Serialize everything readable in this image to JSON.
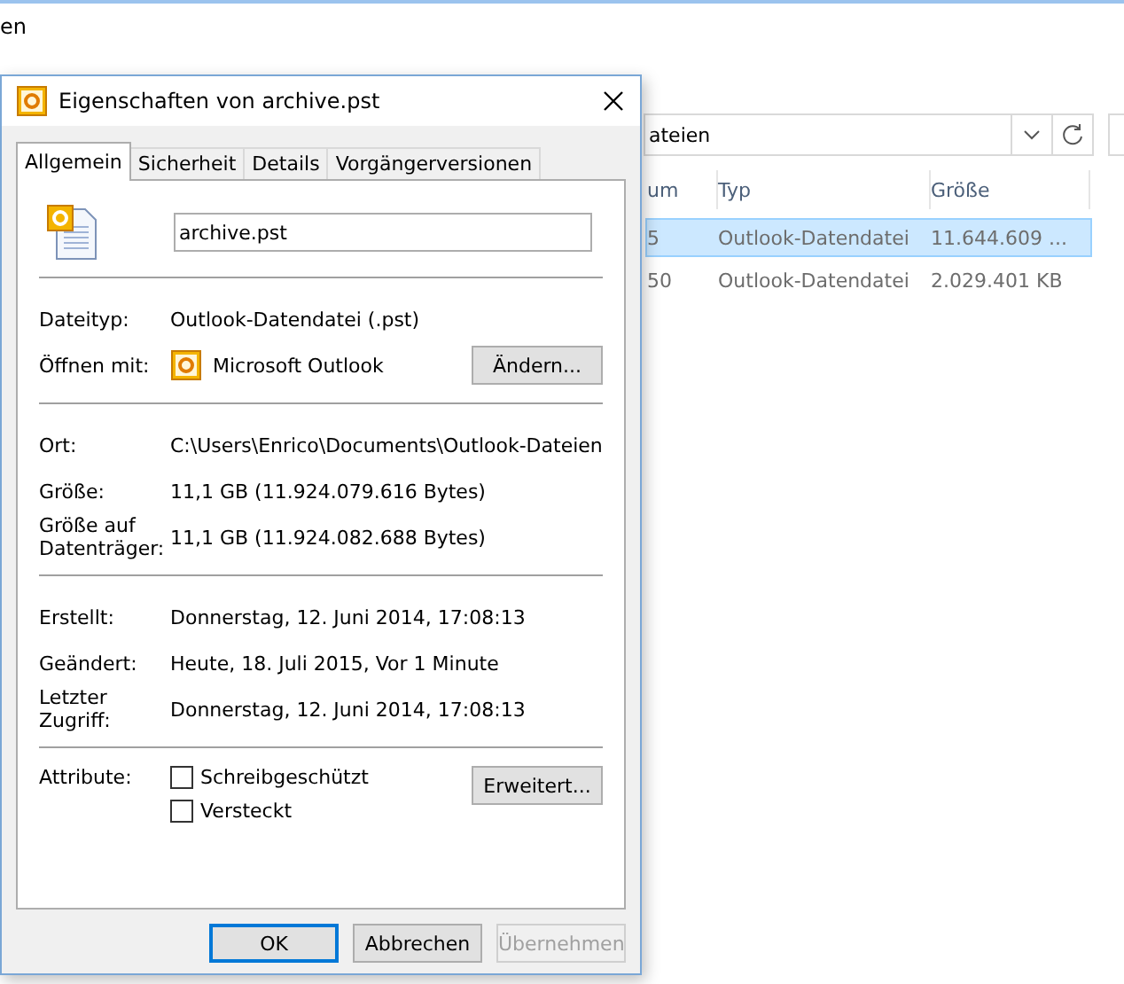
{
  "explorer": {
    "title_fragment": "en",
    "address": "ateien",
    "columns": [
      "um",
      "Typ",
      "Größe"
    ],
    "rows": [
      {
        "cells": [
          "5",
          "Outlook-Datendatei",
          "11.644.609 ..."
        ],
        "selected": true
      },
      {
        "cells": [
          "50",
          "Outlook-Datendatei",
          "2.029.401 KB"
        ],
        "selected": false
      }
    ]
  },
  "dialog": {
    "title": "Eigenschaften von archive.pst",
    "tabs": [
      {
        "label": "Allgemein",
        "selected": true
      },
      {
        "label": "Sicherheit",
        "selected": false
      },
      {
        "label": "Details",
        "selected": false
      },
      {
        "label": "Vorgängerversionen",
        "selected": false
      }
    ],
    "file_name": "archive.pst",
    "sections": [
      [
        {
          "label": "Dateityp:",
          "value": "Outlook-Datendatei (.pst)"
        },
        {
          "label": "Öffnen mit:",
          "value": "Microsoft Outlook",
          "kind": "app",
          "button": "Ändern..."
        }
      ],
      [
        {
          "label": "Ort:",
          "value": "C:\\Users\\Enrico\\Documents\\Outlook-Dateien"
        },
        {
          "label": "Größe:",
          "value": "11,1 GB (11.924.079.616 Bytes)"
        },
        {
          "label": "Größe auf Datenträger:",
          "value": "11,1 GB (11.924.082.688 Bytes)"
        }
      ],
      [
        {
          "label": "Erstellt:",
          "value": "Donnerstag, 12. Juni 2014, 17:08:13"
        },
        {
          "label": "Geändert:",
          "value": "Heute, 18. Juli 2015, Vor 1 Minute"
        },
        {
          "label": "Letzter Zugriff:",
          "value": "Donnerstag, 12. Juni 2014, 17:08:13"
        }
      ]
    ],
    "attributes": {
      "label": "Attribute:",
      "button": "Erweitert...",
      "options": [
        {
          "label": "Schreibgeschützt",
          "checked": false
        },
        {
          "label": "Versteckt",
          "checked": false
        }
      ]
    },
    "buttons": [
      {
        "label": "OK",
        "default": true,
        "disabled": false
      },
      {
        "label": "Abbrechen",
        "default": false,
        "disabled": false
      },
      {
        "label": "Übernehmen",
        "default": false,
        "disabled": true
      }
    ]
  }
}
